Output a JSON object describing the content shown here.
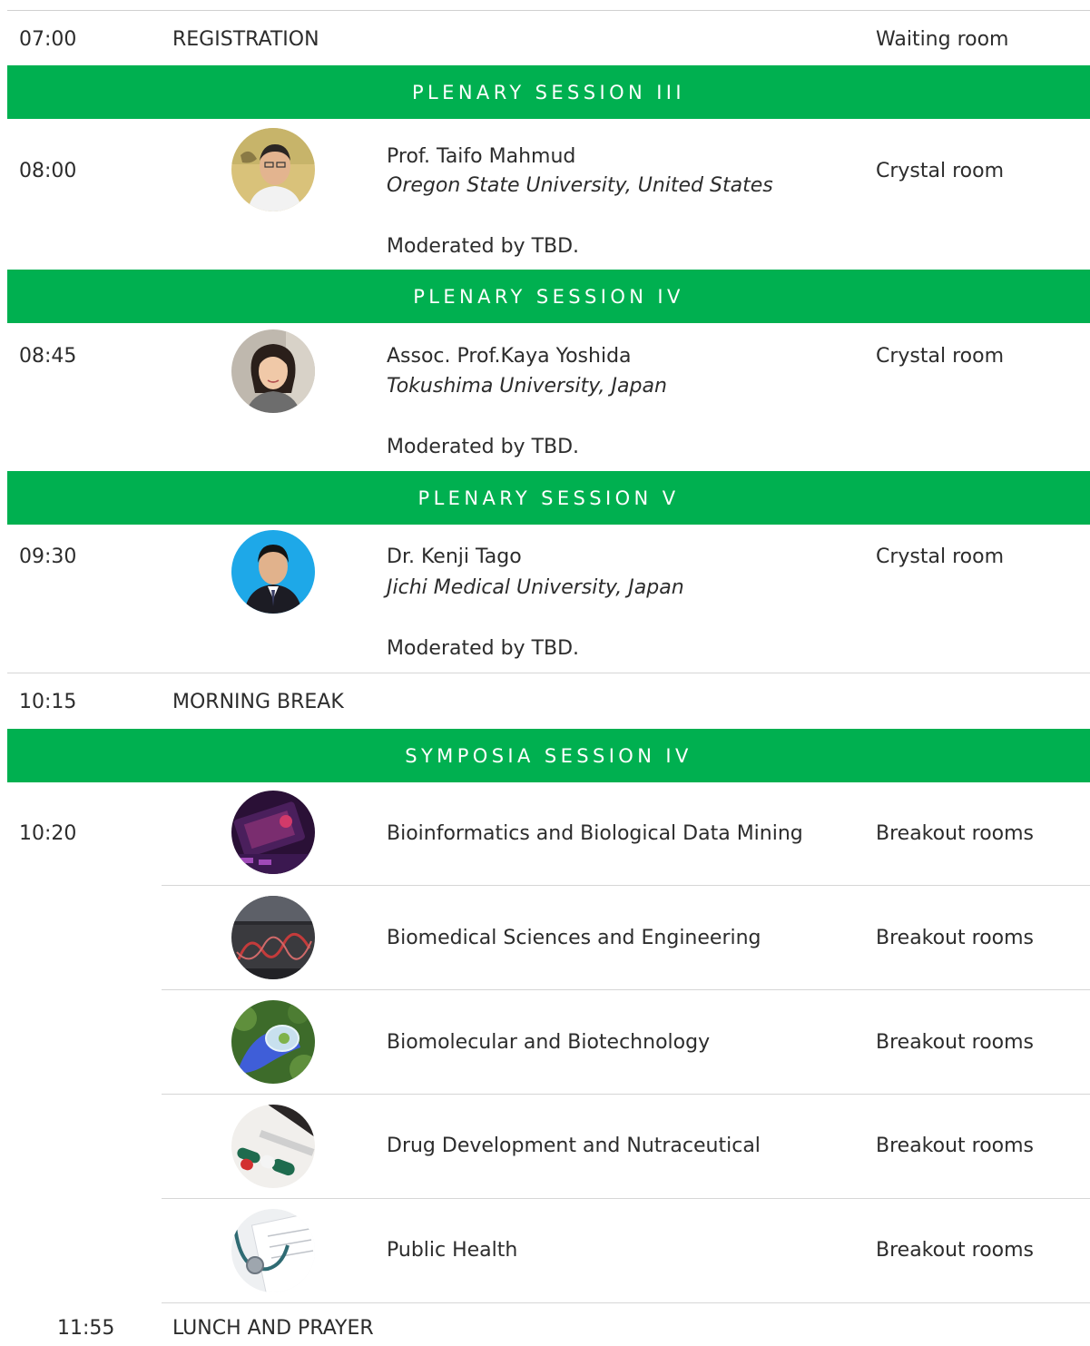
{
  "registration": {
    "time": "07:00",
    "label": "REGISTRATION",
    "room": "Waiting room"
  },
  "sessions": [
    {
      "title": "PLENARY SESSION III",
      "time": "08:00",
      "speaker": "Prof. Taifo Mahmud",
      "affiliation": "Oregon State University, United States",
      "room": "Crystal room",
      "moderator": "Moderated by TBD."
    },
    {
      "title": "PLENARY SESSION IV",
      "time": "08:45",
      "speaker": "Assoc. Prof.Kaya Yoshida",
      "affiliation": "Tokushima University, Japan",
      "room": "Crystal room",
      "moderator": "Moderated by TBD."
    },
    {
      "title": "PLENARY SESSION V",
      "time": "09:30",
      "speaker": "Dr. Kenji Tago",
      "affiliation": "Jichi Medical University, Japan",
      "room": "Crystal room",
      "moderator": "Moderated by TBD."
    }
  ],
  "morning_break": {
    "time": "10:15",
    "label": "MORNING BREAK"
  },
  "symposia": {
    "title": "SYMPOSIA SESSION IV",
    "time": "10:20",
    "topics": [
      {
        "name": "Bioinformatics and Biological Data Mining",
        "room": "Breakout rooms",
        "icon": "bioinformatics-photo"
      },
      {
        "name": "Biomedical Sciences and Engineering",
        "room": "Breakout rooms",
        "icon": "biomedical-photo"
      },
      {
        "name": "Biomolecular and Biotechnology",
        "room": "Breakout rooms",
        "icon": "biomolecular-photo"
      },
      {
        "name": "Drug Development and Nutraceutical",
        "room": "Breakout rooms",
        "icon": "drug-development-photo"
      },
      {
        "name": "Public Health",
        "room": "Breakout rooms",
        "icon": "public-health-photo"
      }
    ]
  },
  "lunch": {
    "time": "11:55",
    "label": "LUNCH AND PRAYER"
  },
  "colors": {
    "band": "#00b050",
    "band_text": "#ffffff",
    "text": "#2c2c2c",
    "rule": "#d6d6d6"
  }
}
